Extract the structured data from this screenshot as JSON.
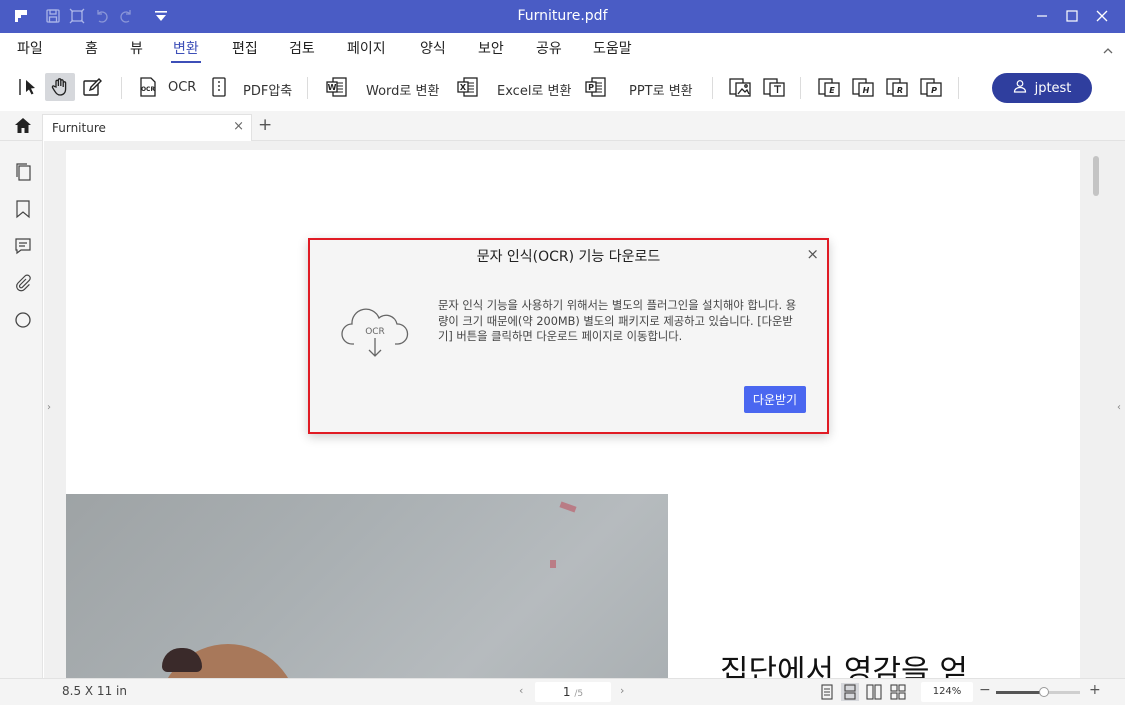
{
  "window": {
    "title": "Furniture.pdf",
    "quick_icons": [
      "app-logo-icon",
      "save-icon",
      "fit-icon",
      "undo-icon",
      "redo-icon",
      "customize-dropdown-icon"
    ],
    "controls": [
      "minimize-icon",
      "maximize-icon",
      "close-icon"
    ]
  },
  "menu": {
    "items": [
      "파일",
      "홈",
      "뷰",
      "변환",
      "편집",
      "검토",
      "페이지",
      "양식",
      "보안",
      "공유",
      "도움말"
    ],
    "active": "변환"
  },
  "toolbar": {
    "ocr_label": "OCR",
    "compress_label": "PDF압축",
    "to_word_label": "Word로 변환",
    "to_excel_label": "Excel로 변환",
    "to_ppt_label": "PPT로 변환",
    "user_name": "jptest"
  },
  "tabs": {
    "doc_tab_label": "Furniture",
    "close_glyph": "×",
    "new_tab_glyph": "+"
  },
  "document": {
    "heading": "집단에서 영감을 얻"
  },
  "dialog": {
    "title": "문자 인식(OCR) 기능 다운로드",
    "close_glyph": "×",
    "icon_text": "OCR",
    "body": "문자 인식 기능을 사용하기 위해서는 별도의 플러그인을 설치해야 합니다. 용량이 크기 때문에(약 200MB) 별도의 패키지로 제공하고 있습니다. [다운받기] 버튼을 클릭하면 다운로드 페이지로 이동합니다.",
    "button_label": "다운받기"
  },
  "status": {
    "page_size": "8.5 X 11 in",
    "prev_glyph": "‹",
    "next_glyph": "›",
    "current_page": "1",
    "total_pages": "/5",
    "zoom": "124%",
    "zoom_level": 0.57,
    "minus_glyph": "−",
    "plus_glyph": "+"
  },
  "colors": {
    "title_bar": "#4a5cc5",
    "accent": "#3d4fb8",
    "user_button": "#2f3e9e",
    "dialog_border": "#e01b24",
    "dialog_button": "#4a67f0"
  }
}
